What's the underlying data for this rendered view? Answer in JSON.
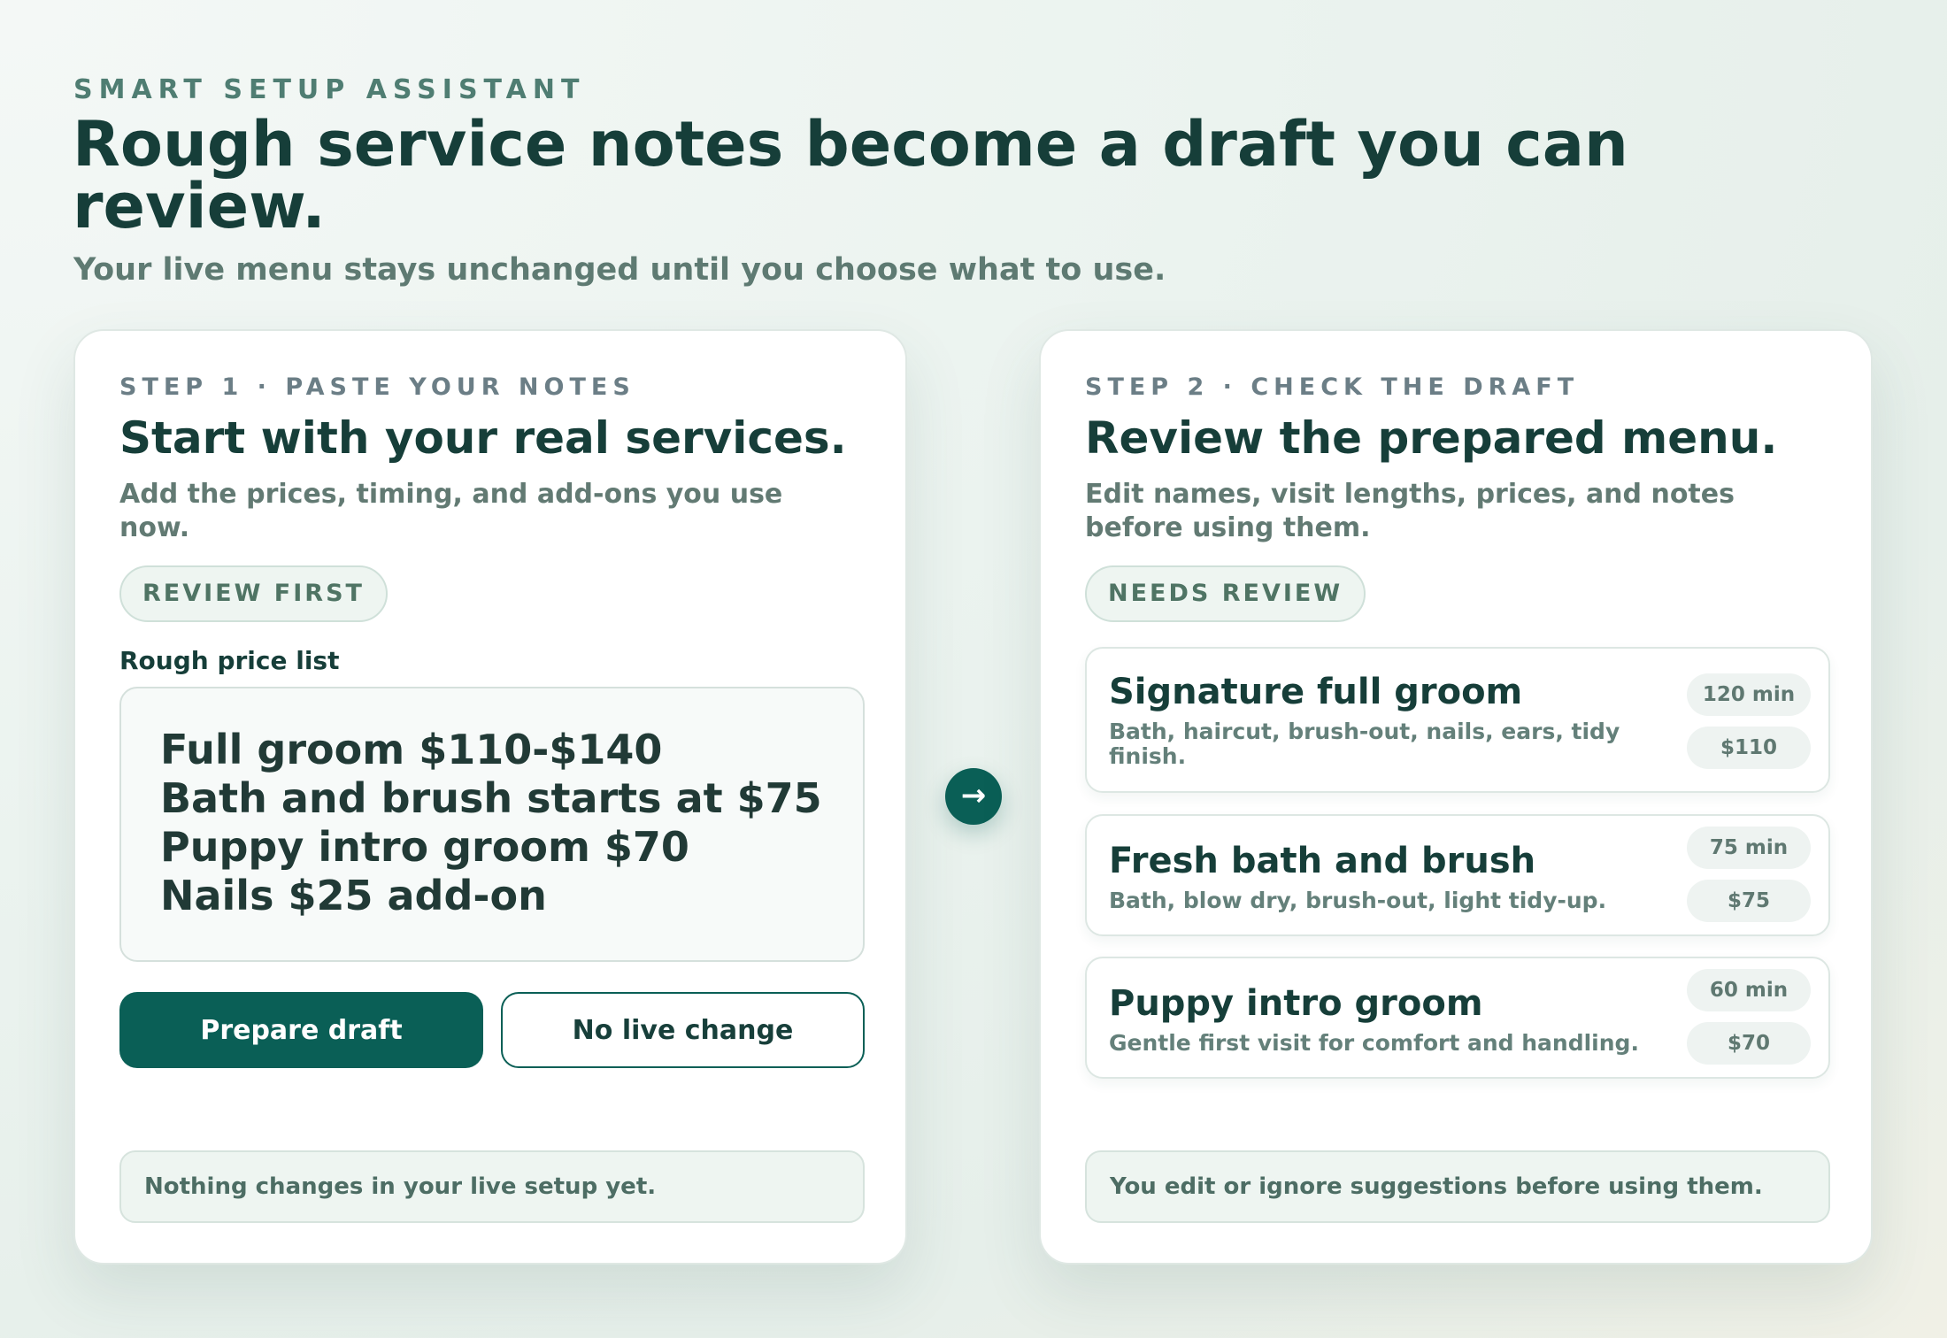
{
  "header": {
    "eyebrow": "SMART SETUP ASSISTANT",
    "title": "Rough service notes become a draft you can review.",
    "subtitle": "Your live menu stays unchanged until you choose what to use."
  },
  "step1": {
    "label": "STEP 1 · PASTE YOUR NOTES",
    "title": "Start with your real services.",
    "description": "Add the prices, timing, and add-ons you use now.",
    "badge": "REVIEW FIRST",
    "field_label": "Rough price list",
    "notes": [
      "Full groom $110-$140",
      "Bath and brush starts at $75",
      "Puppy intro groom $70",
      "Nails $25 add-on"
    ],
    "primary_button": "Prepare draft",
    "secondary_button": "No live change",
    "footer": "Nothing changes in your live setup yet."
  },
  "arrow_icon": "→",
  "step2": {
    "label": "STEP 2 · CHECK THE DRAFT",
    "title": "Review the prepared menu.",
    "description": "Edit names, visit lengths, prices, and notes before using them.",
    "badge": "NEEDS REVIEW",
    "services": [
      {
        "name": "Signature full groom",
        "description": "Bath, haircut, brush-out, nails, ears, tidy finish.",
        "duration": "120 min",
        "price": "$110"
      },
      {
        "name": "Fresh bath and brush",
        "description": "Bath, blow dry, brush-out, light tidy-up.",
        "duration": "75 min",
        "price": "$75"
      },
      {
        "name": "Puppy intro groom",
        "description": "Gentle first visit for comfort and handling.",
        "duration": "60 min",
        "price": "$70"
      }
    ],
    "footer": "You edit or ignore suggestions before using them."
  },
  "colors": {
    "accent": "#0a5f56",
    "heading": "#163e39",
    "muted": "#627a73",
    "card_bg": "#ffffff"
  }
}
